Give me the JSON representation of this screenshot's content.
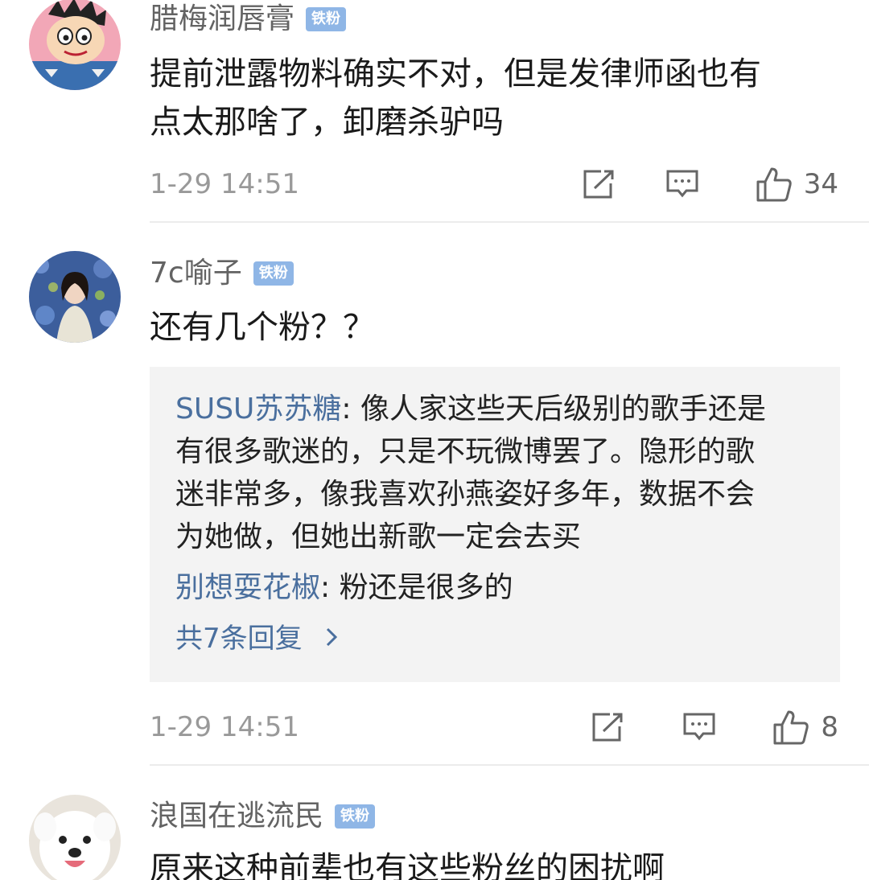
{
  "comments": [
    {
      "username": "腊梅润唇膏",
      "badge": "铁粉",
      "text_line1": "提前泄露物料确实不对，但是发律师函也有",
      "text_line2": "点太那啥了，卸磨杀驴吗",
      "time": "1-29 14:51",
      "likes": "34",
      "avatar_icon": "cartoon-boy-avatar"
    },
    {
      "username": "7c喻子",
      "badge": "铁粉",
      "text": "还有几个粉？？",
      "replies": [
        {
          "author": "SUSU苏苏糖",
          "sep": ": ",
          "line1": "像人家这些天后级别的歌手还是",
          "line2": "有很多歌迷的，只是不玩微博罢了。隐形的歌",
          "line3": "迷非常多，像我喜欢孙燕姿好多年，数据不会",
          "line4": "为她做，但她出新歌一定会去买"
        },
        {
          "author": "别想耍花椒",
          "sep": ": ",
          "line1": "粉还是很多的"
        }
      ],
      "more_replies": "共7条回复",
      "time": "1-29 14:51",
      "likes": "8",
      "avatar_icon": "girl-photo-avatar"
    },
    {
      "username": "浪国在逃流民",
      "badge": "铁粉",
      "text": "原来这种前辈也有这些粉丝的困扰啊",
      "avatar_icon": "dog-photo-avatar"
    }
  ],
  "icons": {
    "share": "share-icon",
    "comment": "comment-icon",
    "like": "thumbs-up-icon",
    "chevron": "chevron-right-icon"
  },
  "colors": {
    "badge": "#8fb6e6",
    "link": "#4a6f9e",
    "quote_bg": "#f3f3f3"
  }
}
